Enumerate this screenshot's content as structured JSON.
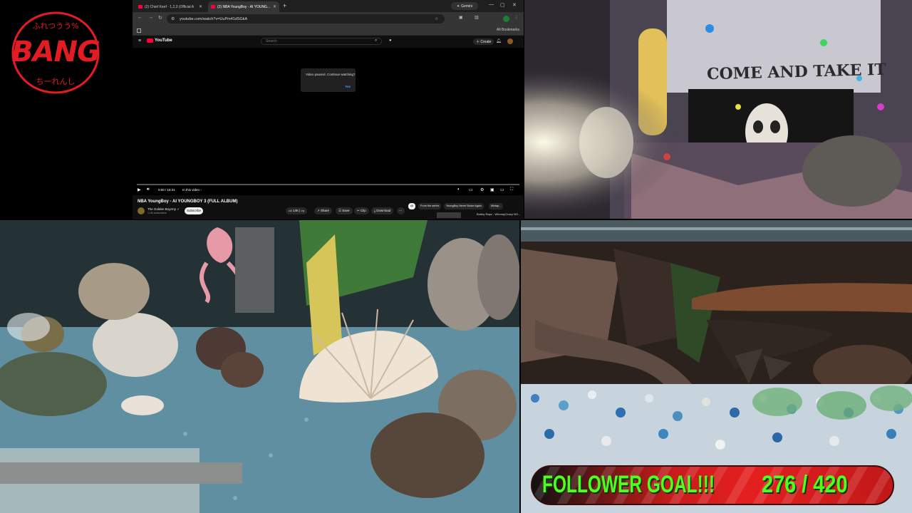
{
  "logo": {
    "top_text": "ふれつうう%",
    "word": "BANG",
    "bottom_text": "ちーれんし"
  },
  "browser": {
    "tabs": [
      {
        "label": "(2) Chief Keef - 1,2,3 (Official A"
      },
      {
        "label": "(2) NBA YoungBoy - AI YOUNG..."
      }
    ],
    "gemini_label": "Gemini",
    "url": "youtube.com/watch?v=UuPm41dSGkA",
    "bookmarks_label": "All Bookmarks",
    "youtube": {
      "brand": "YouTube",
      "search_placeholder": "Search",
      "create_label": "Create",
      "notification_count": "9+",
      "dialog_message": "Video paused. Continue watching?",
      "dialog_yes": "Yes",
      "time": "0:00 / 18:31",
      "in_this_video": "In this video ›",
      "video_title": "NBA YoungBoy - AI YOUNGBOY 3 (FULL ALBUM)",
      "channel_name": "The Golden Boyrmy ✓",
      "channel_subs": "1.1M subscribers",
      "subscribe_label": "Subscribe",
      "likes": "14K",
      "share_label": "Share",
      "save_label": "Save",
      "clip_label": "Clip",
      "download_label": "Download",
      "chips": [
        "All",
        "From the series",
        "YoungBoy Never Broke Again",
        "Mixtap..."
      ],
      "rec_text": "Bobby Rapz - Whomp(Crazy NO..."
    }
  },
  "room": {
    "banner_text": "COME AND TAKE IT"
  },
  "goal": {
    "label": "FOLLOWER GOAL!!!",
    "count": "276 / 420"
  },
  "colors": {
    "brand_red": "#e31b23",
    "goal_green": "#4cff1e",
    "youtube_red": "#ff0033"
  }
}
